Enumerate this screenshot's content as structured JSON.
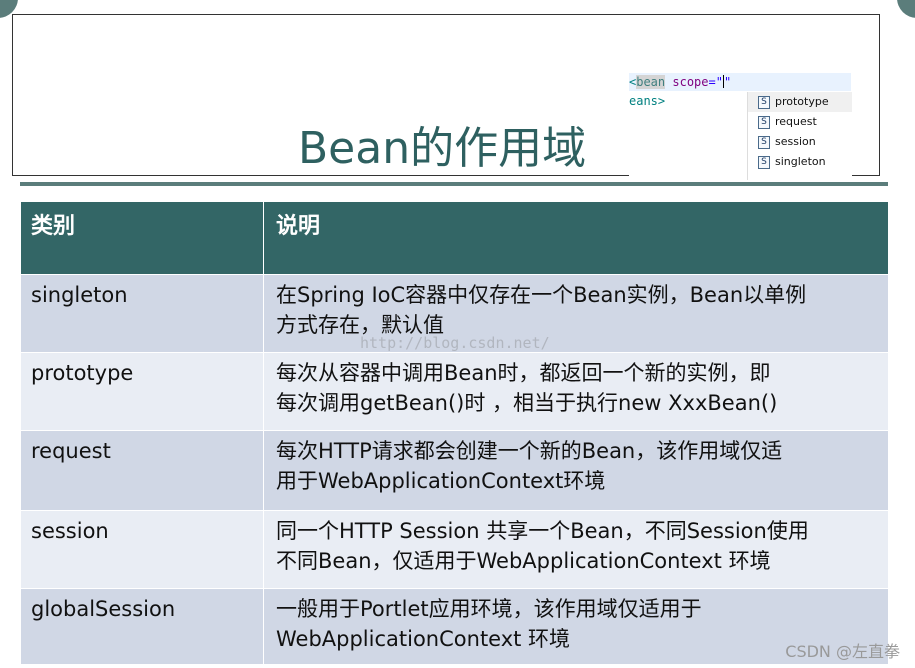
{
  "slide": {
    "title": "Bean的作用域",
    "accent_color": "#336666",
    "title_color": "#2e6060"
  },
  "ide_snippet": {
    "line1": {
      "open_bracket": "<",
      "tag": "bean",
      "attr": "scope",
      "equals_quote": "=\"",
      "close_quote": "\""
    },
    "line2": "eans>",
    "completions": [
      {
        "icon": "S",
        "label": "prototype"
      },
      {
        "icon": "S",
        "label": "request"
      },
      {
        "icon": "S",
        "label": "session"
      },
      {
        "icon": "S",
        "label": "singleton"
      }
    ]
  },
  "table": {
    "header": {
      "col_type": "类别",
      "col_desc": "说明"
    },
    "rows": [
      {
        "type": "singleton",
        "desc_line1": "在Spring IoC容器中仅存在一个Bean实例，Bean以单例",
        "desc_line2": "方式存在，默认值"
      },
      {
        "type": "prototype",
        "desc_line1": "每次从容器中调用Bean时，都返回一个新的实例，即",
        "desc_line2": "每次调用getBean()时 ，相当于执行new XxxBean()"
      },
      {
        "type": "request",
        "desc_line1": "每次HTTP请求都会创建一个新的Bean，该作用域仅适",
        "desc_line2": "用于WebApplicationContext环境"
      },
      {
        "type": "session",
        "desc_line1": "同一个HTTP Session 共享一个Bean，不同Session使用",
        "desc_line2": "不同Bean，仅适用于WebApplicationContext 环境"
      },
      {
        "type": "globalSession",
        "desc_line1": "一般用于Portlet应用环境，该作用域仅适用于",
        "desc_line2": "WebApplicationContext 环境"
      }
    ]
  },
  "watermark": "http://blog.csdn.net/",
  "footer_mark": "CSDN @左直拳"
}
